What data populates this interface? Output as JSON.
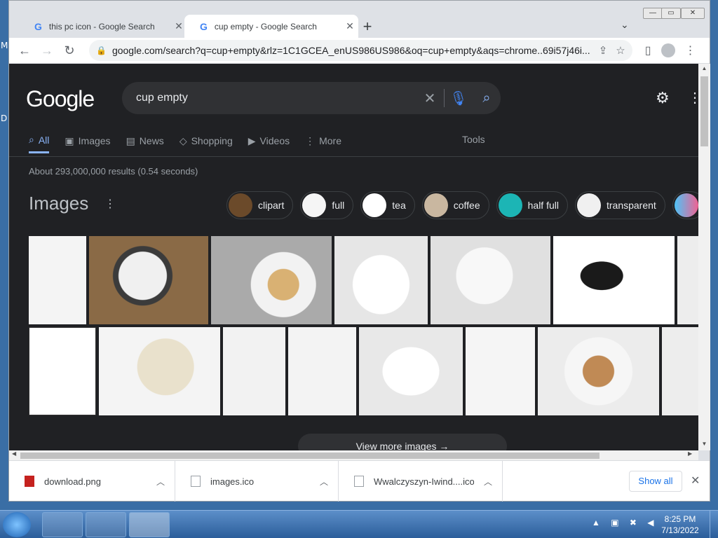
{
  "desktop": {
    "letter_1": "M",
    "letter_2": "D"
  },
  "tabs": [
    {
      "title": "this pc icon - Google Search",
      "active": false
    },
    {
      "title": "cup empty - Google Search",
      "active": true
    }
  ],
  "tabbar": {
    "new_tab": "+",
    "tab_search": "⌄"
  },
  "window_controls": {
    "minimize": "—",
    "restore": "▭",
    "close": "✕"
  },
  "toolbar": {
    "url": "google.com/search?q=cup+empty&rlz=1C1GCEA_enUS986US986&oq=cup+empty&aqs=chrome..69i57j46i..."
  },
  "google": {
    "logo": "Google",
    "query": "cup empty",
    "nav": [
      "All",
      "Images",
      "News",
      "Shopping",
      "Videos",
      "More"
    ],
    "tools": "Tools",
    "stats": "About 293,000,000 results (0.54 seconds)",
    "images_heading": "Images",
    "chips": [
      "clipart",
      "full",
      "tea",
      "coffee",
      "half full",
      "transparent"
    ],
    "view_more": "View more images →"
  },
  "downloads": {
    "items": [
      "download.png",
      "images.ico",
      "Wwalczyszyn-Iwind....ico"
    ],
    "show_all": "Show all"
  },
  "taskbar": {
    "time": "8:25 PM",
    "date": "7/13/2022"
  },
  "colors": {
    "page_bg": "#202124",
    "link_blue": "#8ab4f8",
    "mic_blue": "#4285f4"
  }
}
